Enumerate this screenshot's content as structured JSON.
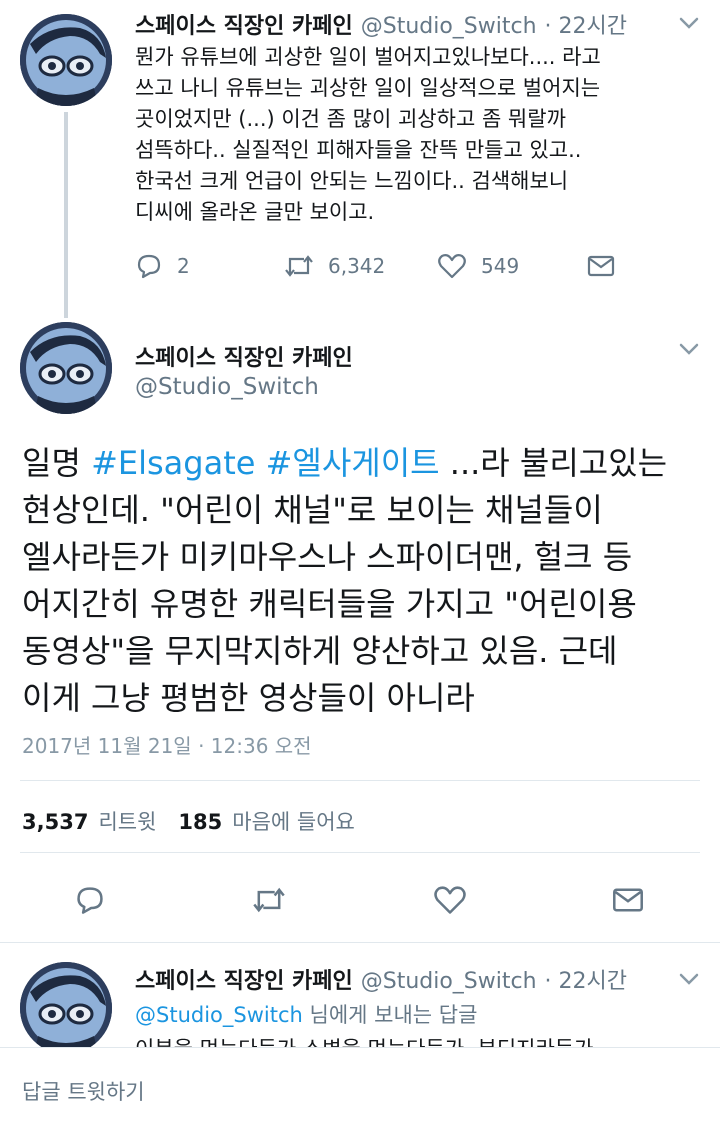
{
  "tweet_1": {
    "author_name": "스페이스 직장인 카페인",
    "author_handle": "@Studio_Switch",
    "time": "· 22시간",
    "text_lines": [
      "뭔가 유튜브에 괴상한 일이 벌어지고있나보다.... 라고",
      "쓰고 나니 유튜브는 괴상한 일이 일상적으로 벌어지는",
      "곳이었지만 (...) 이건 좀 많이 괴상하고 좀 뭐랄까",
      "섬뜩하다.. 실질적인 피해자들을 잔뜩 만들고 있고..",
      "한국선 크게 언급이 안되는 느낌이다.. 검색해보니",
      "디씨에 올라온 글만 보이고."
    ],
    "reply_count": "2",
    "retweet_count": "6,342",
    "like_count": "549"
  },
  "main_tweet": {
    "author_name": "스페이스 직장인 카페인",
    "author_handle": "@Studio_Switch",
    "text_prefix": "일명 ",
    "hashtag_1": "#Elsagate",
    "hashtag_2": "#엘사게이트",
    "text_line1_rest": " ...라 불리고있는",
    "text_lines": [
      "현상인데. \"어린이 채널\"로 보이는 채널들이",
      "엘사라든가 미키마우스나 스파이더맨, 헐크 등",
      "어지간히 유명한 캐릭터들을 가지고 \"어린이용",
      "동영상\"을 무지막지하게 양산하고 있음. 근데",
      "이게 그냥 평범한 영상들이 아니라"
    ],
    "date": "2017년 11월 21일 · 12:36 오전",
    "retweets_value": "3,537",
    "retweets_label": "리트윗",
    "likes_value": "185",
    "likes_label": "마음에 들어요"
  },
  "tweet_3": {
    "author_name": "스페이스 직장인 카페인",
    "author_handle": "@Studio_Switch",
    "time": "· 22시간",
    "reply_to_handle": "@Studio_Switch",
    "reply_to_suffix": " 님에게 보내는 답글",
    "text_partial": "이분을 먹는다든가 소변을 먹는다든가, 부디지라든가"
  },
  "reply_bar": {
    "placeholder": "답글 트윗하기"
  },
  "colors": {
    "accent": "#1b95e0",
    "secondary_text": "#657786",
    "divider": "#e1e8ed"
  },
  "icons": [
    "reply-icon",
    "retweet-icon",
    "like-icon",
    "message-icon",
    "chevron-down-icon"
  ]
}
